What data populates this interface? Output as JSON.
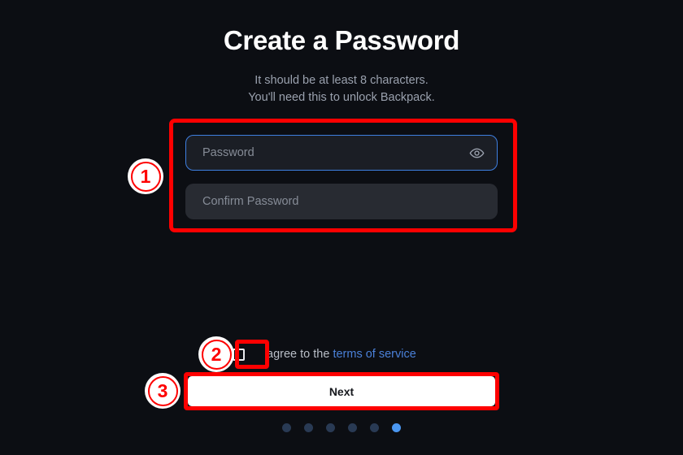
{
  "screen": {
    "background_color": "#0c0e13",
    "title": "Create a Password",
    "subtitle_line1": "It should be at least 8 characters.",
    "subtitle_line2": "You'll need this to unlock Backpack."
  },
  "form": {
    "password_field": {
      "placeholder": "Password",
      "value": "",
      "focused": true,
      "border_color": "#3e7fe0",
      "toggle_icon": "eye-icon"
    },
    "confirm_field": {
      "placeholder": "Confirm Password",
      "value": "",
      "focused": false
    }
  },
  "terms": {
    "checked": false,
    "text_prefix": "agree to the",
    "link_label": "terms of service",
    "link_color": "#4a80d8"
  },
  "actions": {
    "next_label": "Next",
    "next_bg_color": "#ffffff",
    "next_text_color": "#16181d"
  },
  "pagination": {
    "total": 6,
    "active_index": 5,
    "inactive_color": "#293a54",
    "active_color": "#4a96f0",
    "dots": [
      "1",
      "2",
      "3",
      "4",
      "5",
      "6"
    ]
  },
  "annotations": {
    "highlight_color": "#fe0000",
    "markers": [
      {
        "id": "1",
        "label": "1",
        "target": "password-fields"
      },
      {
        "id": "2",
        "label": "2",
        "target": "terms-checkbox"
      },
      {
        "id": "3",
        "label": "3",
        "target": "next-button"
      }
    ]
  }
}
